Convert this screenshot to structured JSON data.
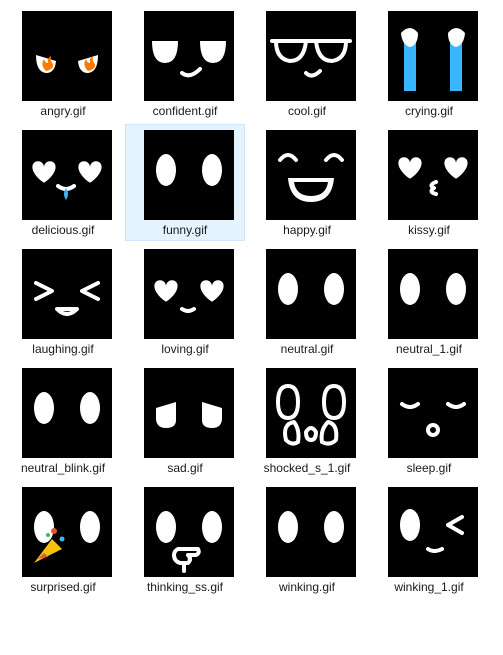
{
  "files": [
    {
      "name": "angry.gif",
      "icon": "angry-face-icon",
      "selected": false
    },
    {
      "name": "confident.gif",
      "icon": "confident-face-icon",
      "selected": false
    },
    {
      "name": "cool.gif",
      "icon": "cool-face-icon",
      "selected": false
    },
    {
      "name": "crying.gif",
      "icon": "crying-face-icon",
      "selected": false
    },
    {
      "name": "delicious.gif",
      "icon": "delicious-face-icon",
      "selected": false
    },
    {
      "name": "funny.gif",
      "icon": "funny-face-icon",
      "selected": true
    },
    {
      "name": "happy.gif",
      "icon": "happy-face-icon",
      "selected": false
    },
    {
      "name": "kissy.gif",
      "icon": "kissy-face-icon",
      "selected": false
    },
    {
      "name": "laughing.gif",
      "icon": "laughing-face-icon",
      "selected": false
    },
    {
      "name": "loving.gif",
      "icon": "loving-face-icon",
      "selected": false
    },
    {
      "name": "neutral.gif",
      "icon": "neutral-face-icon",
      "selected": false
    },
    {
      "name": "neutral_1.gif",
      "icon": "neutral-1-face-icon",
      "selected": false
    },
    {
      "name": "neutral_blink.gif",
      "icon": "neutral-blink-face-icon",
      "selected": false
    },
    {
      "name": "sad.gif",
      "icon": "sad-face-icon",
      "selected": false
    },
    {
      "name": "shocked_s_1.gif",
      "icon": "shocked-face-icon",
      "selected": false
    },
    {
      "name": "sleep.gif",
      "icon": "sleep-face-icon",
      "selected": false
    },
    {
      "name": "surprised.gif",
      "icon": "surprised-face-icon",
      "selected": false
    },
    {
      "name": "thinking_ss.gif",
      "icon": "thinking-face-icon",
      "selected": false
    },
    {
      "name": "winking.gif",
      "icon": "winking-face-icon",
      "selected": false
    },
    {
      "name": "winking_1.gif",
      "icon": "winking-1-face-icon",
      "selected": false
    }
  ],
  "colors": {
    "selection_bg": "#e5f3ff",
    "selection_border": "#cce8ff",
    "thumb_bg": "#000000",
    "tear": "#38b6ff",
    "flame": "#ff7a00"
  }
}
